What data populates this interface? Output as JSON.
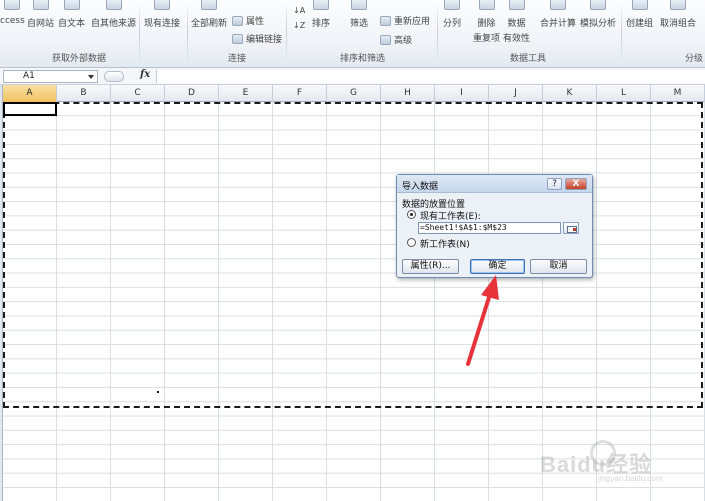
{
  "ribbon": {
    "buttons": [
      {
        "label": "ccess"
      },
      {
        "label": "自网站"
      },
      {
        "label": "自文本"
      },
      {
        "label": "自其他来源"
      },
      {
        "label": "现有连接"
      },
      {
        "label": "全部刷新"
      },
      {
        "label": "排序"
      },
      {
        "label": "筛选"
      },
      {
        "label": "分列"
      },
      {
        "label": "删除",
        "label2": "重复项"
      },
      {
        "label": "数据",
        "label2": "有效性"
      },
      {
        "label": "合并计算"
      },
      {
        "label": "模拟分析"
      },
      {
        "label": "创建组"
      },
      {
        "label": "取消组合"
      }
    ],
    "small": {
      "properties": "属性",
      "edit_links": "编辑链接",
      "reapply": "重新应用",
      "advanced": "高级"
    },
    "groups": {
      "external": "获取外部数据",
      "connections": "连接",
      "sort_filter": "排序和筛选",
      "data_tools": "数据工具",
      "outline": "分级"
    }
  },
  "formula_bar": {
    "name_box": "A1",
    "fx": "fx"
  },
  "columns": [
    "A",
    "B",
    "C",
    "D",
    "E",
    "F",
    "G",
    "H",
    "I",
    "J",
    "K",
    "L",
    "M"
  ],
  "selected_column": "A",
  "dialog": {
    "title": "导入数据",
    "help": "?",
    "close": "X",
    "section": "数据的放置位置",
    "existing_sheet": "现有工作表(E):",
    "range": "=Sheet1!$A$1:$M$23",
    "new_sheet": "新工作表(N)",
    "properties_button": "属性(R)...",
    "ok_button": "确定",
    "cancel_button": "取消"
  },
  "watermark": {
    "text": "Baidu经验",
    "sub": "jingyan.baidu.com"
  },
  "colors": {
    "arrow": "#e8323a",
    "selected_header": "#f1c15f"
  }
}
